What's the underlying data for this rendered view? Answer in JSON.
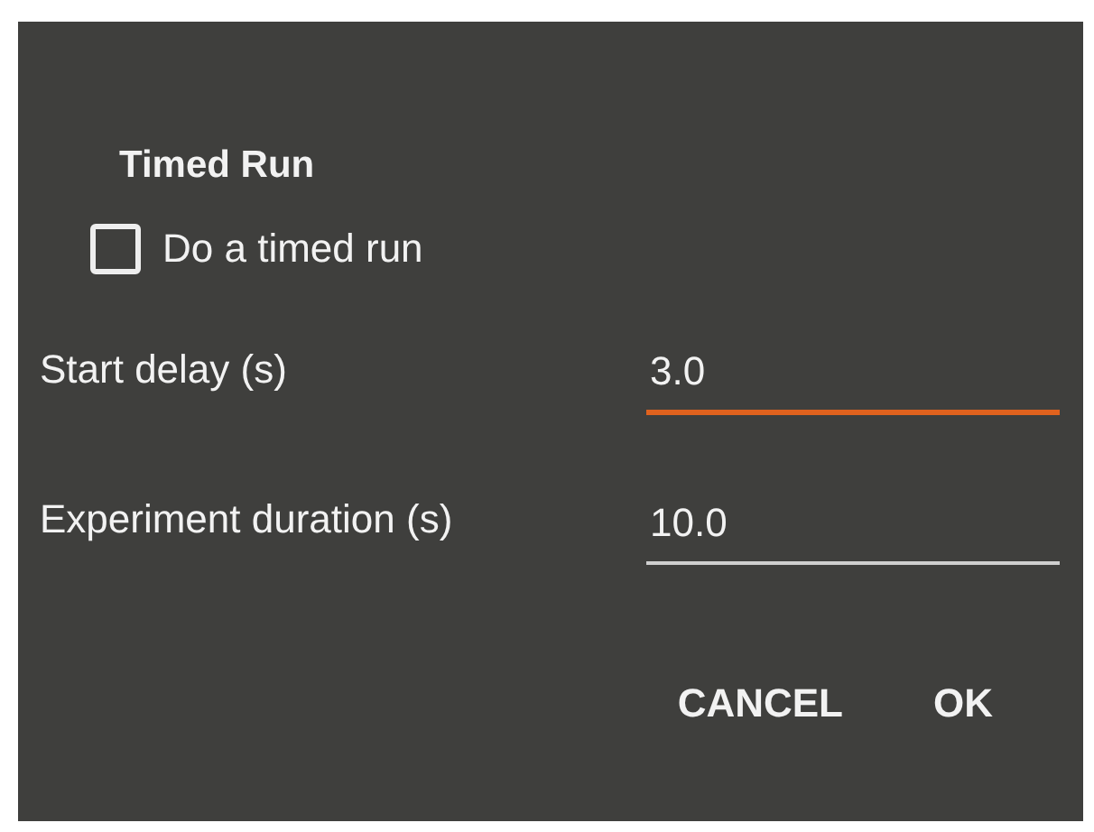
{
  "dialog": {
    "title": "Timed Run",
    "checkbox": {
      "label": "Do a timed run",
      "checked": false
    },
    "fields": [
      {
        "label": "Start delay (s)",
        "value": "3.0",
        "focused": true
      },
      {
        "label": "Experiment duration (s)",
        "value": "10.0",
        "focused": false
      }
    ],
    "buttons": [
      "CANCEL",
      "OK"
    ]
  }
}
